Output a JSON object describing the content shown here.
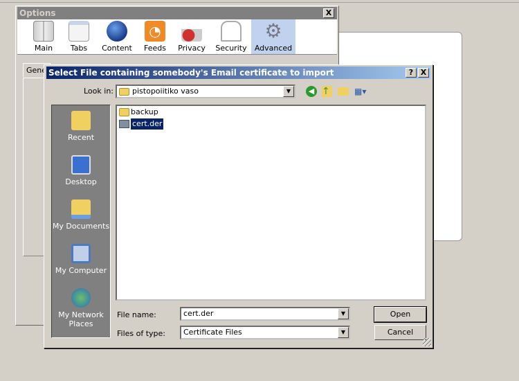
{
  "options_window": {
    "title": "Options",
    "close_label": "X",
    "toolbar": [
      {
        "label": "Main",
        "icon": "main-icon"
      },
      {
        "label": "Tabs",
        "icon": "tabs-icon"
      },
      {
        "label": "Content",
        "icon": "globe-icon"
      },
      {
        "label": "Feeds",
        "icon": "rss-icon"
      },
      {
        "label": "Privacy",
        "icon": "privacy-lock-icon"
      },
      {
        "label": "Security",
        "icon": "padlock-icon"
      },
      {
        "label": "Advanced",
        "icon": "gear-icon",
        "selected": true
      }
    ],
    "tab_partial": "Gene"
  },
  "file_dialog": {
    "title": "Select File containing somebody's Email certificate to import",
    "help_label": "?",
    "close_label": "X",
    "look_in_label": "Look in:",
    "look_in_value": "pistopoiitiko vaso",
    "places": [
      "Recent",
      "Desktop",
      "My Documents",
      "My Computer",
      "My Network Places"
    ],
    "files": [
      {
        "name": "backup",
        "type": "folder"
      },
      {
        "name": "cert.der",
        "type": "certificate",
        "selected": true
      }
    ],
    "file_name_label": "File name:",
    "file_name_value": "cert.der",
    "file_type_label": "Files of type:",
    "file_type_value": "Certificate Files",
    "open_label": "Open",
    "cancel_label": "Cancel"
  },
  "colors": {
    "title_active_start": "#0a246a",
    "title_active_end": "#a6caf0",
    "selection": "#0a246a",
    "face": "#d4d0c8"
  }
}
